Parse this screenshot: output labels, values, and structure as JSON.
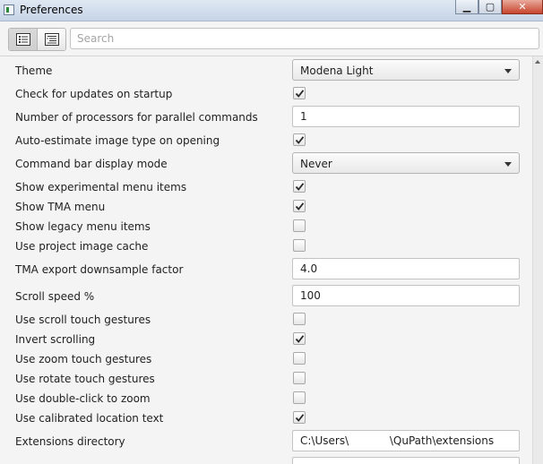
{
  "window": {
    "title": "Preferences"
  },
  "toolbar": {
    "search_placeholder": "Search"
  },
  "prefs": {
    "theme": {
      "label": "Theme",
      "value": "Modena Light"
    },
    "check_updates": {
      "label": "Check for updates on startup",
      "checked": true
    },
    "num_processors": {
      "label": "Number of processors for parallel commands",
      "value": "1"
    },
    "auto_estimate": {
      "label": "Auto-estimate image type on opening",
      "checked": true
    },
    "command_bar_mode": {
      "label": "Command bar display mode",
      "value": "Never"
    },
    "experimental_menu": {
      "label": "Show experimental menu items",
      "checked": true
    },
    "tma_menu": {
      "label": "Show TMA menu",
      "checked": true
    },
    "legacy_menu": {
      "label": "Show legacy menu items",
      "checked": false
    },
    "project_cache": {
      "label": "Use project image cache",
      "checked": false
    },
    "tma_downsample": {
      "label": "TMA export downsample factor",
      "value": "4.0"
    },
    "scroll_speed": {
      "label": "Scroll speed %",
      "value": "100"
    },
    "scroll_touch": {
      "label": "Use scroll touch gestures",
      "checked": false
    },
    "invert_scrolling": {
      "label": "Invert scrolling",
      "checked": true
    },
    "zoom_touch": {
      "label": "Use zoom touch gestures",
      "checked": false
    },
    "rotate_touch": {
      "label": "Use rotate touch gestures",
      "checked": false
    },
    "double_click_zoom": {
      "label": "Use double-click to zoom",
      "checked": false
    },
    "calibrated_location": {
      "label": "Use calibrated location text",
      "checked": true
    },
    "extensions_dir": {
      "label": "Extensions directory",
      "value": "C:\\Users\\            \\QuPath\\extensions"
    },
    "partial_next": {
      "value": ""
    }
  },
  "icons": {
    "app": "app-window-icon",
    "list_view": "list-view-icon",
    "tree_view": "tree-view-icon"
  }
}
